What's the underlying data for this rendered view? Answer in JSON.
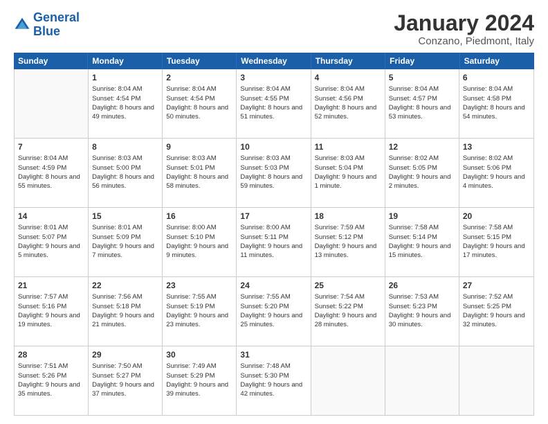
{
  "header": {
    "logo_line1": "General",
    "logo_line2": "Blue",
    "main_title": "January 2024",
    "subtitle": "Conzano, Piedmont, Italy"
  },
  "calendar": {
    "day_headers": [
      "Sunday",
      "Monday",
      "Tuesday",
      "Wednesday",
      "Thursday",
      "Friday",
      "Saturday"
    ],
    "weeks": [
      [
        {
          "day": "",
          "empty": true
        },
        {
          "day": "1",
          "sunrise": "8:04 AM",
          "sunset": "4:54 PM",
          "daylight": "8 hours and 49 minutes."
        },
        {
          "day": "2",
          "sunrise": "8:04 AM",
          "sunset": "4:54 PM",
          "daylight": "8 hours and 50 minutes."
        },
        {
          "day": "3",
          "sunrise": "8:04 AM",
          "sunset": "4:55 PM",
          "daylight": "8 hours and 51 minutes."
        },
        {
          "day": "4",
          "sunrise": "8:04 AM",
          "sunset": "4:56 PM",
          "daylight": "8 hours and 52 minutes."
        },
        {
          "day": "5",
          "sunrise": "8:04 AM",
          "sunset": "4:57 PM",
          "daylight": "8 hours and 53 minutes."
        },
        {
          "day": "6",
          "sunrise": "8:04 AM",
          "sunset": "4:58 PM",
          "daylight": "8 hours and 54 minutes."
        }
      ],
      [
        {
          "day": "7",
          "sunrise": "8:04 AM",
          "sunset": "4:59 PM",
          "daylight": "8 hours and 55 minutes."
        },
        {
          "day": "8",
          "sunrise": "8:03 AM",
          "sunset": "5:00 PM",
          "daylight": "8 hours and 56 minutes."
        },
        {
          "day": "9",
          "sunrise": "8:03 AM",
          "sunset": "5:01 PM",
          "daylight": "8 hours and 58 minutes."
        },
        {
          "day": "10",
          "sunrise": "8:03 AM",
          "sunset": "5:03 PM",
          "daylight": "8 hours and 59 minutes."
        },
        {
          "day": "11",
          "sunrise": "8:03 AM",
          "sunset": "5:04 PM",
          "daylight": "9 hours and 1 minute."
        },
        {
          "day": "12",
          "sunrise": "8:02 AM",
          "sunset": "5:05 PM",
          "daylight": "9 hours and 2 minutes."
        },
        {
          "day": "13",
          "sunrise": "8:02 AM",
          "sunset": "5:06 PM",
          "daylight": "9 hours and 4 minutes."
        }
      ],
      [
        {
          "day": "14",
          "sunrise": "8:01 AM",
          "sunset": "5:07 PM",
          "daylight": "9 hours and 5 minutes."
        },
        {
          "day": "15",
          "sunrise": "8:01 AM",
          "sunset": "5:09 PM",
          "daylight": "9 hours and 7 minutes."
        },
        {
          "day": "16",
          "sunrise": "8:00 AM",
          "sunset": "5:10 PM",
          "daylight": "9 hours and 9 minutes."
        },
        {
          "day": "17",
          "sunrise": "8:00 AM",
          "sunset": "5:11 PM",
          "daylight": "9 hours and 11 minutes."
        },
        {
          "day": "18",
          "sunrise": "7:59 AM",
          "sunset": "5:12 PM",
          "daylight": "9 hours and 13 minutes."
        },
        {
          "day": "19",
          "sunrise": "7:58 AM",
          "sunset": "5:14 PM",
          "daylight": "9 hours and 15 minutes."
        },
        {
          "day": "20",
          "sunrise": "7:58 AM",
          "sunset": "5:15 PM",
          "daylight": "9 hours and 17 minutes."
        }
      ],
      [
        {
          "day": "21",
          "sunrise": "7:57 AM",
          "sunset": "5:16 PM",
          "daylight": "9 hours and 19 minutes."
        },
        {
          "day": "22",
          "sunrise": "7:56 AM",
          "sunset": "5:18 PM",
          "daylight": "9 hours and 21 minutes."
        },
        {
          "day": "23",
          "sunrise": "7:55 AM",
          "sunset": "5:19 PM",
          "daylight": "9 hours and 23 minutes."
        },
        {
          "day": "24",
          "sunrise": "7:55 AM",
          "sunset": "5:20 PM",
          "daylight": "9 hours and 25 minutes."
        },
        {
          "day": "25",
          "sunrise": "7:54 AM",
          "sunset": "5:22 PM",
          "daylight": "9 hours and 28 minutes."
        },
        {
          "day": "26",
          "sunrise": "7:53 AM",
          "sunset": "5:23 PM",
          "daylight": "9 hours and 30 minutes."
        },
        {
          "day": "27",
          "sunrise": "7:52 AM",
          "sunset": "5:25 PM",
          "daylight": "9 hours and 32 minutes."
        }
      ],
      [
        {
          "day": "28",
          "sunrise": "7:51 AM",
          "sunset": "5:26 PM",
          "daylight": "9 hours and 35 minutes."
        },
        {
          "day": "29",
          "sunrise": "7:50 AM",
          "sunset": "5:27 PM",
          "daylight": "9 hours and 37 minutes."
        },
        {
          "day": "30",
          "sunrise": "7:49 AM",
          "sunset": "5:29 PM",
          "daylight": "9 hours and 39 minutes."
        },
        {
          "day": "31",
          "sunrise": "7:48 AM",
          "sunset": "5:30 PM",
          "daylight": "9 hours and 42 minutes."
        },
        {
          "day": "",
          "empty": true
        },
        {
          "day": "",
          "empty": true
        },
        {
          "day": "",
          "empty": true
        }
      ]
    ]
  }
}
